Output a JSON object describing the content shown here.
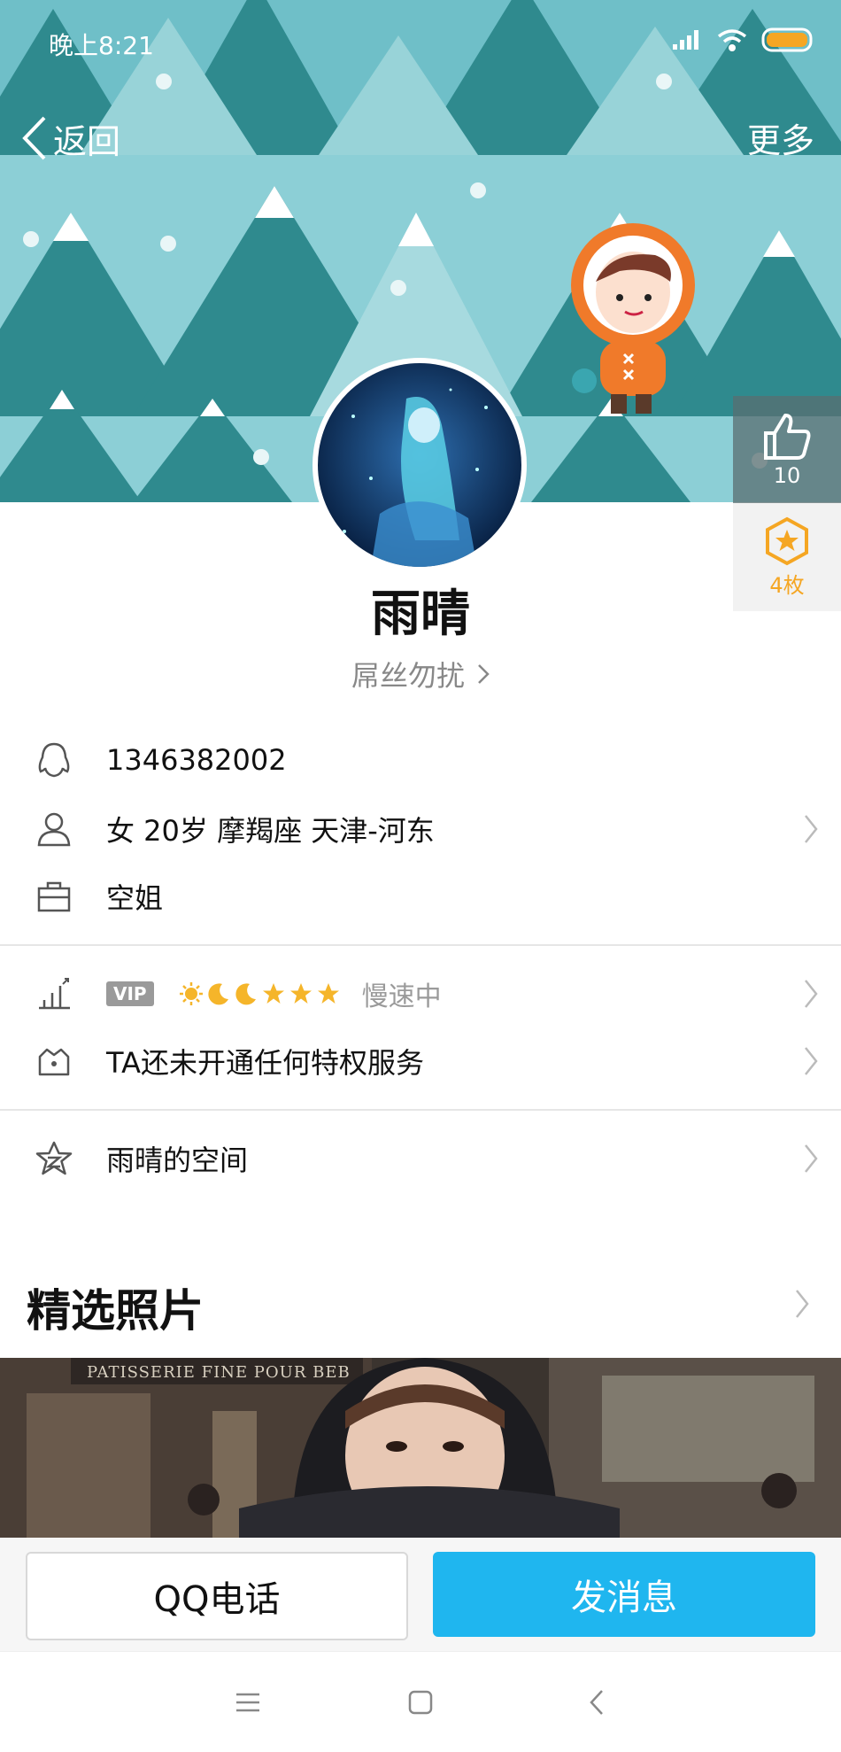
{
  "status_bar": {
    "time": "晚上8:21"
  },
  "nav": {
    "back_label": "返回",
    "more_label": "更多"
  },
  "likes": {
    "count": "10"
  },
  "medals": {
    "count": "4枚"
  },
  "profile": {
    "nickname": "雨晴",
    "signature": "屌丝勿扰"
  },
  "info": {
    "qq_number": "1346382002",
    "basic": "女  20岁  摩羯座  天津-河东",
    "occupation": "空姐",
    "vip_label": "VIP",
    "level_note": "慢速中",
    "privilege": "TA还未开通任何特权服务",
    "space": "雨晴的空间"
  },
  "photos": {
    "title": "精选照片",
    "shop_sign": "PATISSERIE FINE POUR BEB"
  },
  "actions": {
    "call_label": "QQ电话",
    "message_label": "发消息"
  },
  "colors": {
    "accent": "#1fb6ef",
    "banner": "#8ccfd6",
    "tree_dark": "#2f8a8e",
    "medal": "#f5a623"
  }
}
